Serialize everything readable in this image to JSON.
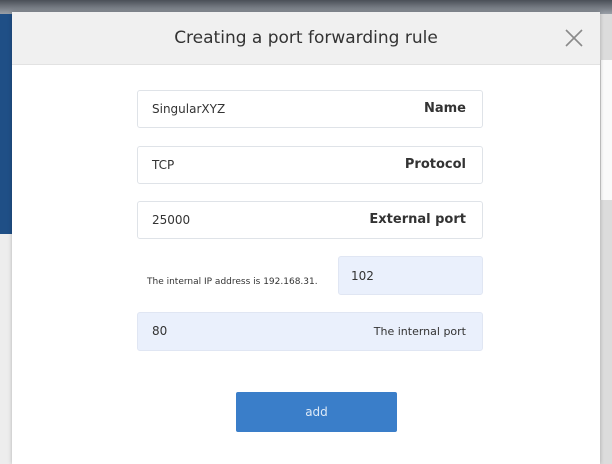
{
  "dialog": {
    "title": "Creating a port forwarding rule",
    "close_icon": "close-icon"
  },
  "form": {
    "name": {
      "value": "SingularXYZ",
      "label": "Name"
    },
    "protocol": {
      "value": "TCP",
      "label": "Protocol"
    },
    "external_port": {
      "value": "25000",
      "label": "External port"
    },
    "internal_ip": {
      "prefix": "The internal IP address is 192.168.31.",
      "value": "102"
    },
    "internal_port": {
      "value": "80",
      "label": "The internal port"
    }
  },
  "actions": {
    "add_label": "add"
  },
  "colors": {
    "accent": "#3a7ec9",
    "field_shaded": "#eaf0fc"
  }
}
